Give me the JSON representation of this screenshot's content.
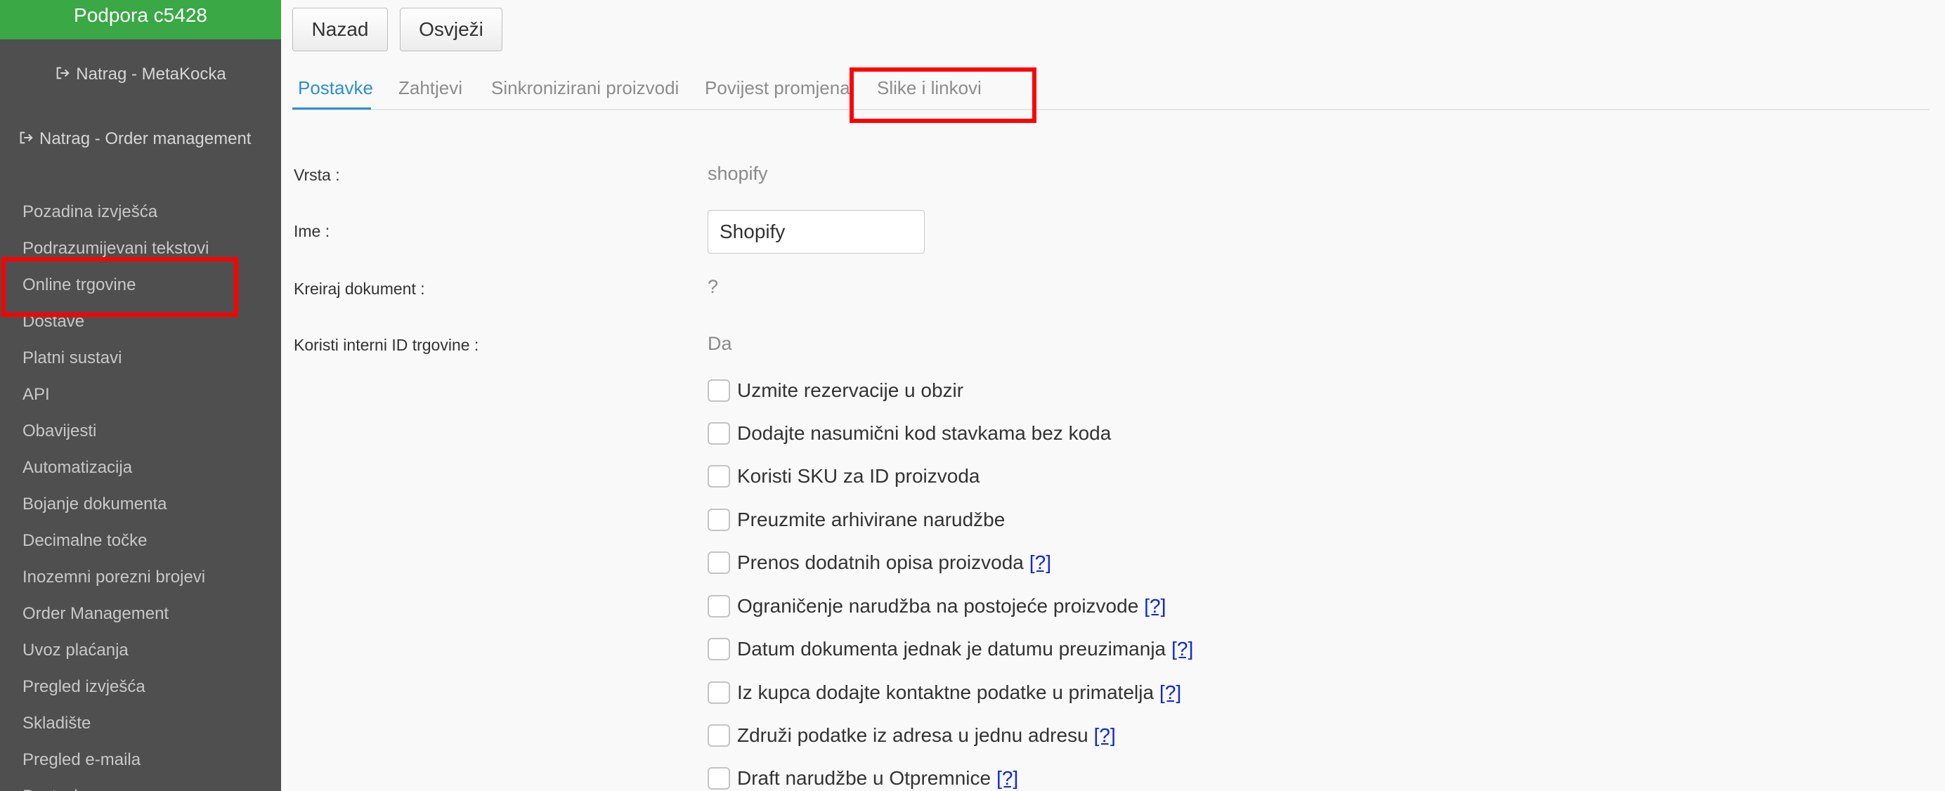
{
  "sidebar": {
    "title": "Podpora c5428",
    "back_links": [
      "Natrag - MetaKocka",
      "Natrag - Order management"
    ],
    "items": [
      "Pozadina izvješća",
      "Podrazumijevani tekstovi",
      "Online trgovine",
      "Dostave",
      "Platni sustavi",
      "API",
      "Obavijesti",
      "Automatizacija",
      "Bojanje dokumenta",
      "Decimalne točke",
      "Inozemni porezni brojevi",
      "Order Management",
      "Uvoz plaćanja",
      "Pregled izvješća",
      "Skladište",
      "Pregled e-maila",
      "Postavke"
    ]
  },
  "toolbar": {
    "back_label": "Nazad",
    "refresh_label": "Osvježi"
  },
  "tabs": [
    "Postavke",
    "Zahtjevi",
    "Sinkronizirani proizvodi",
    "Povijest promjena",
    "Slike i linkovi"
  ],
  "active_tab": "Postavke",
  "form": {
    "type_label": "Vrsta :",
    "type_value": "shopify",
    "name_label": "Ime :",
    "name_value": "Shopify",
    "create_doc_label": "Kreiraj dokument :",
    "create_doc_value": "?",
    "internal_id_label": "Koristi interni ID trgovine :",
    "internal_id_value": "Da",
    "help_text": "[?]",
    "checkboxes": [
      {
        "label": "Uzmite rezervacije u obzir",
        "help": false,
        "checked": false
      },
      {
        "label": "Dodajte nasumični kod stavkama bez koda",
        "help": false,
        "checked": false
      },
      {
        "label": "Koristi SKU za ID proizvoda",
        "help": false,
        "checked": false
      },
      {
        "label": "Preuzmite arhivirane narudžbe",
        "help": false,
        "checked": false
      },
      {
        "label": "Prenos dodatnih opisa proizvoda",
        "help": true,
        "checked": false
      },
      {
        "label": "Ograničenje narudžba na postojeće proizvode",
        "help": true,
        "checked": false
      },
      {
        "label": "Datum dokumenta jednak je datumu preuzimanja",
        "help": true,
        "checked": false
      },
      {
        "label": "Iz kupca dodajte kontaktne podatke u primatelja",
        "help": true,
        "checked": false
      },
      {
        "label": "Združi podatke iz adresa u jednu adresu",
        "help": true,
        "checked": false
      },
      {
        "label": "Draft narudžbe u Otpremnice",
        "help": true,
        "checked": false
      }
    ]
  },
  "colors": {
    "header_green": "#39a845",
    "sidebar_bg": "#4f4f4f",
    "active_tab": "#2a8fd6",
    "highlight_red": "#ff0000",
    "help_link": "#0b24e6"
  }
}
